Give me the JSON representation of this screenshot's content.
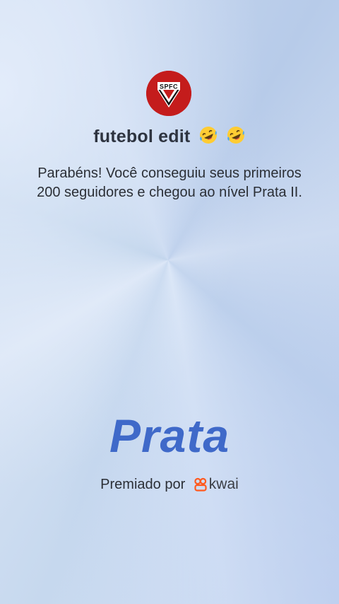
{
  "profile": {
    "avatar_text": "SPFC",
    "title": "futebol edit",
    "title_emoji": [
      "rofl-emoji",
      "rofl-emoji"
    ]
  },
  "message": "Parabéns! Você conseguiu seus primeiros 200 seguidores e chegou ao nível Prata II.",
  "level": {
    "name": "Prata",
    "color": "#3f69c9"
  },
  "award": {
    "label": "Premiado por",
    "brand": "kwai",
    "brand_color": "#ff5a1f"
  },
  "colors": {
    "avatar_bg": "#c41c1c",
    "text": "#2b2f36"
  }
}
